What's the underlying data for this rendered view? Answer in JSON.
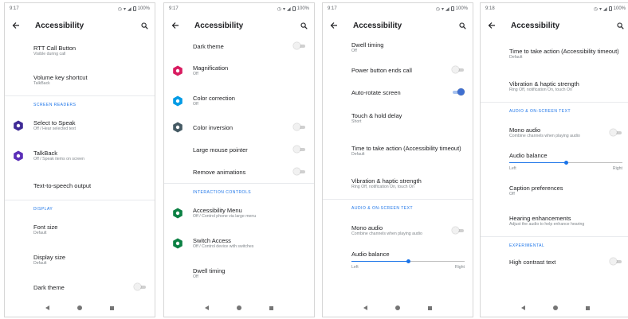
{
  "app_title": "Accessibility",
  "colors": {
    "accent": "#1a73e8",
    "switch_icon": "#0b8043",
    "magnification_icon": "#d81b60",
    "color_correction_icon": "#039be5",
    "select_to_speak_icon": "#3f2b96"
  },
  "screens": [
    {
      "time": "9:17",
      "battery": "100%",
      "list": [
        {
          "kind": "item",
          "title": "RTT Call Button",
          "summary": "Visible during call",
          "h": 36
        },
        {
          "kind": "item",
          "title": "Volume key shortcut",
          "summary": "TalkBack",
          "h": 38
        },
        {
          "kind": "divider"
        },
        {
          "kind": "header",
          "text": "SCREEN READERS",
          "h": 18
        },
        {
          "kind": "item",
          "title": "Select to Speak",
          "summary": "Off / Hear selected text",
          "icon": "select-to-speak-icon",
          "h": 38
        },
        {
          "kind": "item",
          "title": "TalkBack",
          "summary": "Off / Speak items on screen",
          "icon": "talkback-icon",
          "h": 38
        },
        {
          "kind": "item",
          "title": "Text-to-speech output",
          "h": 36
        },
        {
          "kind": "divider"
        },
        {
          "kind": "header",
          "text": "DISPLAY",
          "h": 18
        },
        {
          "kind": "item",
          "title": "Font size",
          "summary": "Default",
          "h": 38
        },
        {
          "kind": "item",
          "title": "Display size",
          "summary": "Default",
          "h": 38
        },
        {
          "kind": "item",
          "title": "Dark theme",
          "toggle": "off",
          "h": 30
        }
      ]
    },
    {
      "time": "9:17",
      "battery": "100%",
      "list": [
        {
          "kind": "item",
          "title": "Dark theme",
          "toggle": "off",
          "h": 24
        },
        {
          "kind": "item",
          "title": "Magnification",
          "summary": "Off",
          "icon": "magnification-icon",
          "h": 38
        },
        {
          "kind": "item",
          "title": "Color correction",
          "summary": "Off",
          "icon": "color-correction-icon",
          "h": 38
        },
        {
          "kind": "item",
          "title": "Color inversion",
          "toggle": "off",
          "icon": "color-inversion-icon",
          "h": 28
        },
        {
          "kind": "item",
          "title": "Large mouse pointer",
          "toggle": "off",
          "h": 28
        },
        {
          "kind": "item",
          "title": "Remove animations",
          "toggle": "off",
          "h": 28
        },
        {
          "kind": "divider"
        },
        {
          "kind": "header",
          "text": "INTERACTION CONTROLS",
          "h": 18
        },
        {
          "kind": "item",
          "title": "Accessibility Menu",
          "summary": "Off / Control phone via large menu",
          "icon": "accessibility-menu-icon",
          "h": 38
        },
        {
          "kind": "item",
          "title": "Switch Access",
          "summary": "Off / Control device with switches",
          "icon": "switch-access-icon",
          "h": 38
        },
        {
          "kind": "item",
          "title": "Dwell timing",
          "summary": "Off",
          "h": 38
        }
      ]
    },
    {
      "time": "9:17",
      "battery": "100%",
      "list": [
        {
          "kind": "item",
          "title": "Dwell timing",
          "summary": "Off",
          "h": 28
        },
        {
          "kind": "item",
          "title": "Power button ends call",
          "toggle": "off",
          "h": 28
        },
        {
          "kind": "item",
          "title": "Auto-rotate screen",
          "toggle": "on",
          "h": 28
        },
        {
          "kind": "item",
          "title": "Touch & hold delay",
          "summary": "Short",
          "h": 38
        },
        {
          "kind": "item",
          "title": "Time to take action (Accessibility timeout)",
          "summary": "Default",
          "h": 44
        },
        {
          "kind": "item",
          "title": "Vibration & haptic strength",
          "summary": "Ring Off, notification On, touch On",
          "h": 38
        },
        {
          "kind": "divider"
        },
        {
          "kind": "header",
          "text": "AUDIO & ON-SCREEN TEXT",
          "h": 18
        },
        {
          "kind": "item",
          "title": "Mono audio",
          "summary": "Combine channels when playing audio",
          "toggle": "off",
          "h": 42
        },
        {
          "kind": "slider",
          "title": "Audio balance",
          "left": "Left",
          "right": "Right",
          "value": 0.5
        }
      ]
    },
    {
      "time": "9:18",
      "battery": "100%",
      "list": [
        {
          "kind": "item",
          "title": "Time to take action (Accessibility timeout)",
          "summary": "Default",
          "h": 44
        },
        {
          "kind": "item",
          "title": "Vibration & haptic strength",
          "summary": "Ring Off, notification On, touch On",
          "h": 38
        },
        {
          "kind": "divider"
        },
        {
          "kind": "header",
          "text": "AUDIO & ON-SCREEN TEXT",
          "h": 18
        },
        {
          "kind": "item",
          "title": "Mono audio",
          "summary": "Combine channels when playing audio",
          "toggle": "off",
          "h": 40
        },
        {
          "kind": "slider",
          "title": "Audio balance",
          "left": "Left",
          "right": "Right",
          "value": 0.5
        },
        {
          "kind": "item",
          "title": "Caption preferences",
          "summary": "Off",
          "h": 38
        },
        {
          "kind": "item",
          "title": "Hearing enhancements",
          "summary": "Adjust the audio to help enhance hearing",
          "h": 38
        },
        {
          "kind": "divider"
        },
        {
          "kind": "header",
          "text": "EXPERIMENTAL",
          "h": 18
        },
        {
          "kind": "item",
          "title": "High contrast text",
          "toggle": "off",
          "h": 26
        }
      ]
    }
  ]
}
